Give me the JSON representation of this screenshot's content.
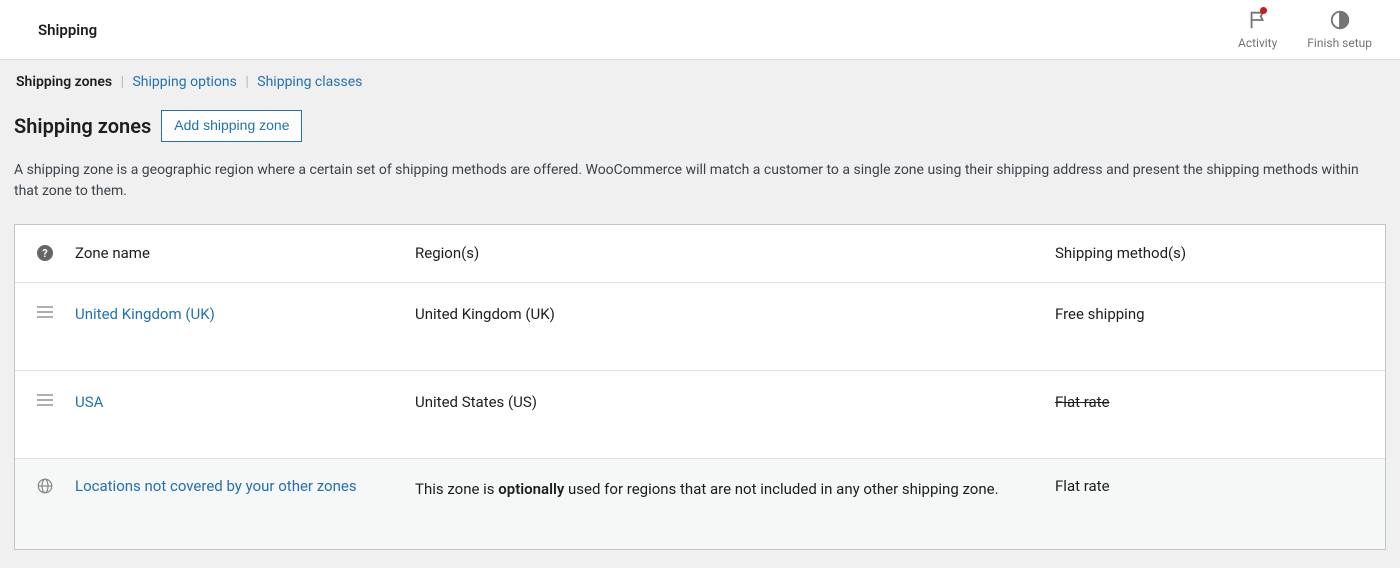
{
  "topbar": {
    "title": "Shipping",
    "activity_label": "Activity",
    "finish_label": "Finish setup"
  },
  "subnav": {
    "zones": "Shipping zones",
    "options": "Shipping options",
    "classes": "Shipping classes"
  },
  "heading": {
    "title": "Shipping zones",
    "add_button": "Add shipping zone"
  },
  "description": "A shipping zone is a geographic region where a certain set of shipping methods are offered. WooCommerce will match a customer to a single zone using their shipping address and present the shipping methods within that zone to them.",
  "table": {
    "header": {
      "name": "Zone name",
      "region": "Region(s)",
      "method": "Shipping method(s)"
    },
    "rows": [
      {
        "name": "United Kingdom (UK)",
        "region": "United Kingdom (UK)",
        "method": "Free shipping",
        "method_strike": false
      },
      {
        "name": "USA",
        "region": "United States (US)",
        "method": "Flat rate",
        "method_strike": true
      }
    ],
    "fallback": {
      "name": "Locations not covered by your other zones",
      "region_pre": "This zone is ",
      "region_bold": "optionally",
      "region_post": " used for regions that are not included in any other shipping zone.",
      "method": "Flat rate"
    }
  }
}
